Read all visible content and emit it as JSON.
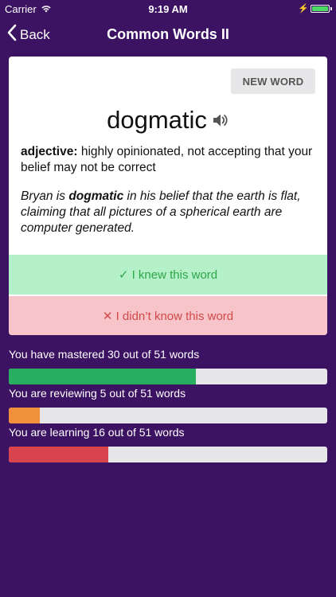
{
  "status_bar": {
    "carrier": "Carrier",
    "time": "9:19 AM",
    "battery_color": "#4cd964"
  },
  "nav": {
    "back_label": "Back",
    "title": "Common Words II"
  },
  "card": {
    "new_word_label": "NEW WORD",
    "word": "dogmatic",
    "definition": {
      "part_of_speech": "adjective:",
      "text": " highly opinionated, not accepting that your belief may not be correct"
    },
    "example": {
      "before": "Bryan is ",
      "bold": "dogmatic",
      "after": " in his belief that the earth is flat, claiming that all pictures of a spherical earth are computer generated."
    },
    "knew_label": "✓ I knew this word",
    "didnt_know_label": "✕ I didn’t know this word"
  },
  "progress": [
    {
      "label": "You have mastered 30 out of 51 words",
      "count": 30,
      "total": 51,
      "color": "#27ae60"
    },
    {
      "label": "You are reviewing 5 out of 51 words",
      "count": 5,
      "total": 51,
      "color": "#f0903a"
    },
    {
      "label": "You are learning 16 out of 51 words",
      "count": 16,
      "total": 51,
      "color": "#d9434e"
    }
  ],
  "colors": {
    "background": "#3c1262",
    "knew_bg": "#b4f0c8",
    "didnt_know_bg": "#f7c4c9"
  }
}
